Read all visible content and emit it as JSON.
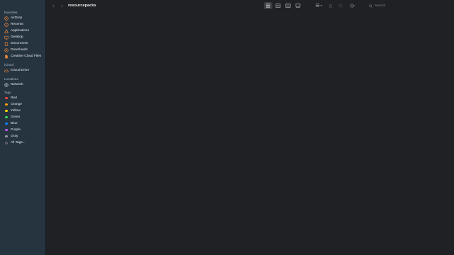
{
  "window": {
    "title": "resourcepacks"
  },
  "sidebar": {
    "favorites_title": "Favorites",
    "favorites": [
      {
        "label": "AirDrop",
        "icon": "airdrop-icon"
      },
      {
        "label": "Recents",
        "icon": "clock-icon"
      },
      {
        "label": "Applications",
        "icon": "applications-icon"
      },
      {
        "label": "Desktop",
        "icon": "desktop-icon"
      },
      {
        "label": "Documents",
        "icon": "document-icon"
      },
      {
        "label": "Downloads",
        "icon": "downloads-icon"
      },
      {
        "label": "Creative Cloud Files",
        "icon": "creative-cloud-file-icon"
      }
    ],
    "icloud_title": "iCloud",
    "icloud": [
      {
        "label": "iCloud Drive",
        "icon": "cloud-icon"
      }
    ],
    "locations_title": "Locations",
    "locations": [
      {
        "label": "Network",
        "icon": "network-globe-icon"
      }
    ],
    "tags_title": "Tags",
    "tags": [
      {
        "label": "Red",
        "color": "#ff453a"
      },
      {
        "label": "Orange",
        "color": "#ff9f0a"
      },
      {
        "label": "Yellow",
        "color": "#ffd60a"
      },
      {
        "label": "Green",
        "color": "#32d74b"
      },
      {
        "label": "Blue",
        "color": "#0a84ff"
      },
      {
        "label": "Purple",
        "color": "#bf5af2"
      },
      {
        "label": "Gray",
        "color": "#98989d"
      },
      {
        "label": "All Tags...",
        "color": ""
      }
    ]
  },
  "toolbar": {
    "views": [
      "icon-view-icon",
      "list-view-icon",
      "column-view-icon",
      "gallery-view-icon"
    ],
    "active_view": 0,
    "search_placeholder": "Search"
  },
  "colors": {
    "accent": "#e8853a",
    "sidebar_bg": "#263440",
    "content_bg": "#1f2124"
  }
}
